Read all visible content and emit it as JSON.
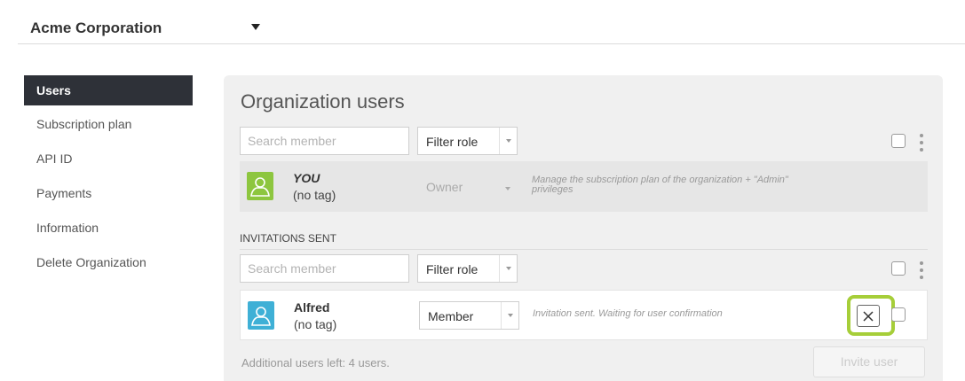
{
  "header": {
    "org_name": "Acme Corporation",
    "org_dropdown_icon": "caret-down-icon"
  },
  "sidebar": {
    "items": [
      {
        "label": "Users",
        "active": true
      },
      {
        "label": "Subscription plan",
        "active": false
      },
      {
        "label": "API ID",
        "active": false
      },
      {
        "label": "Payments",
        "active": false
      },
      {
        "label": "Information",
        "active": false
      },
      {
        "label": "Delete Organization",
        "active": false
      }
    ]
  },
  "main": {
    "title": "Organization users",
    "users_toolbar": {
      "search_placeholder": "Search member",
      "filter_label": "Filter role"
    },
    "owner_row": {
      "name": "YOU",
      "tag": "(no tag)",
      "role": "Owner",
      "description": "Manage the subscription plan of the organization + \"Admin\" privileges",
      "avatar_icon": "user-icon"
    },
    "invitations": {
      "section_label": "INVITATIONS SENT",
      "toolbar": {
        "search_placeholder": "Search member",
        "filter_label": "Filter role"
      },
      "rows": [
        {
          "name": "Alfred",
          "tag": "(no tag)",
          "role": "Member",
          "description": "Invitation sent. Waiting for user confirmation",
          "avatar_icon": "user-icon",
          "cancel_icon": "close-icon"
        }
      ]
    },
    "footer": {
      "users_left": "Additional users left: 4 users.",
      "invite_label": "Invite user"
    }
  },
  "colors": {
    "sidebar_active_bg": "#2e3138",
    "owner_avatar": "#8dc63f",
    "member_avatar": "#3fb0d6",
    "highlight": "#a6ce39",
    "panel_bg": "#f0f0f0"
  }
}
